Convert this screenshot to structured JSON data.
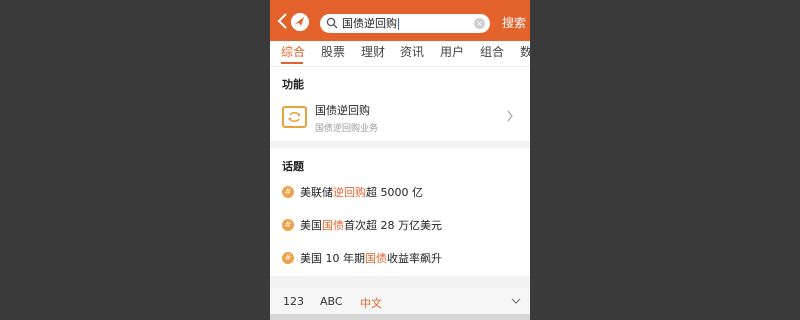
{
  "header": {
    "search_value": "国债逆回购",
    "search_button": "搜索"
  },
  "tabs": [
    {
      "label": "综合",
      "active": true
    },
    {
      "label": "股票"
    },
    {
      "label": "理财"
    },
    {
      "label": "资讯"
    },
    {
      "label": "用户"
    },
    {
      "label": "组合"
    },
    {
      "label": "数"
    }
  ],
  "function_section": {
    "title": "功能",
    "item": {
      "name": "国债逆回购",
      "subtitle": "国债逆回购业务",
      "icon": "exchange-icon"
    }
  },
  "topic_section": {
    "title": "话题",
    "topics": [
      {
        "before": "美联储",
        "highlight": "逆回购",
        "after": "超 5000 亿"
      },
      {
        "before": "美国",
        "highlight": "国债",
        "after": "首次超 28 万亿美元"
      },
      {
        "before": "美国 10 年期",
        "highlight": "国债",
        "after": "收益率飙升"
      }
    ]
  },
  "keyboard_bar": {
    "items": [
      "123",
      "ABC",
      "中文"
    ],
    "active": "中文"
  },
  "colors": {
    "accent": "#e4632c",
    "topic_icon": "#f2a04a",
    "background": "#3a3a3a"
  }
}
